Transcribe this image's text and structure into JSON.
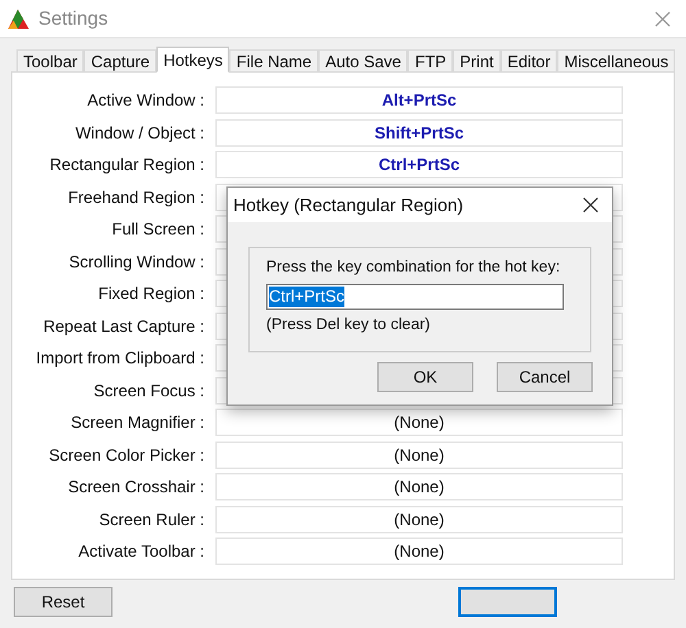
{
  "window": {
    "title": "Settings"
  },
  "tabs": [
    {
      "label": "Toolbar",
      "selected": false
    },
    {
      "label": "Capture",
      "selected": false
    },
    {
      "label": "Hotkeys",
      "selected": true
    },
    {
      "label": "File Name",
      "selected": false
    },
    {
      "label": "Auto Save",
      "selected": false
    },
    {
      "label": "FTP",
      "selected": false
    },
    {
      "label": "Print",
      "selected": false
    },
    {
      "label": "Editor",
      "selected": false
    },
    {
      "label": "Miscellaneous",
      "selected": false
    }
  ],
  "hotkeys": [
    {
      "label": "Active Window :",
      "value": "Alt+PrtSc",
      "assigned": true
    },
    {
      "label": "Window / Object :",
      "value": "Shift+PrtSc",
      "assigned": true
    },
    {
      "label": "Rectangular Region :",
      "value": "Ctrl+PrtSc",
      "assigned": true
    },
    {
      "label": "Freehand Region :"
    },
    {
      "label": "Full Screen :"
    },
    {
      "label": "Scrolling Window :"
    },
    {
      "label": "Fixed Region :"
    },
    {
      "label": "Repeat Last Capture :"
    },
    {
      "label": "Import from Clipboard :"
    },
    {
      "label": "Screen Focus :"
    },
    {
      "label": "Screen Magnifier :",
      "value": "(None)",
      "assigned": false
    },
    {
      "label": "Screen Color Picker :",
      "value": "(None)",
      "assigned": false
    },
    {
      "label": "Screen Crosshair :",
      "value": "(None)",
      "assigned": false
    },
    {
      "label": "Screen Ruler :",
      "value": "(None)",
      "assigned": false
    },
    {
      "label": "Activate Toolbar :",
      "value": "(None)",
      "assigned": false
    }
  ],
  "reset_button": "Reset",
  "dialog": {
    "title": "Hotkey (Rectangular Region)",
    "prompt": "Press the key combination for the hot key:",
    "value": "Ctrl+PrtSc",
    "hint": "(Press Del key to clear)",
    "buttons": [
      "OK",
      "Cancel"
    ]
  }
}
